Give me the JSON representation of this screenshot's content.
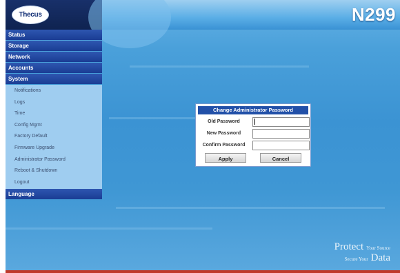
{
  "header": {
    "logo_text": "Thecus",
    "model": "N299"
  },
  "sidebar": {
    "status": "Status",
    "storage": "Storage",
    "network": "Network",
    "accounts": "Accounts",
    "system": "System",
    "system_items": [
      {
        "label": "Notifications"
      },
      {
        "label": "Logs"
      },
      {
        "label": "Time"
      },
      {
        "label": "Config Mgmt"
      },
      {
        "label": "Factory Default"
      },
      {
        "label": "Firmware Upgrade"
      },
      {
        "label": "Administrator Password"
      },
      {
        "label": "Reboot & Shutdown"
      },
      {
        "label": "Logout"
      }
    ],
    "language": "Language"
  },
  "dialog": {
    "title": "Change Administrator Password",
    "old_password_label": "Old Password",
    "new_password_label": "New Password",
    "confirm_password_label": "Confirm Password",
    "old_password_value": "",
    "new_password_value": "",
    "confirm_password_value": "",
    "apply_label": "Apply",
    "cancel_label": "Cancel"
  },
  "footer": {
    "tagline_protect": "Protect",
    "tagline_your_source": "Your Source",
    "tagline_secure_your": "Secure Your",
    "tagline_data": "Data"
  },
  "colors": {
    "menu_header": "#1a3d94",
    "submenu_bg": "#9fcdf0",
    "dialog_title": "#2250a8",
    "background": "#3f97d4"
  }
}
